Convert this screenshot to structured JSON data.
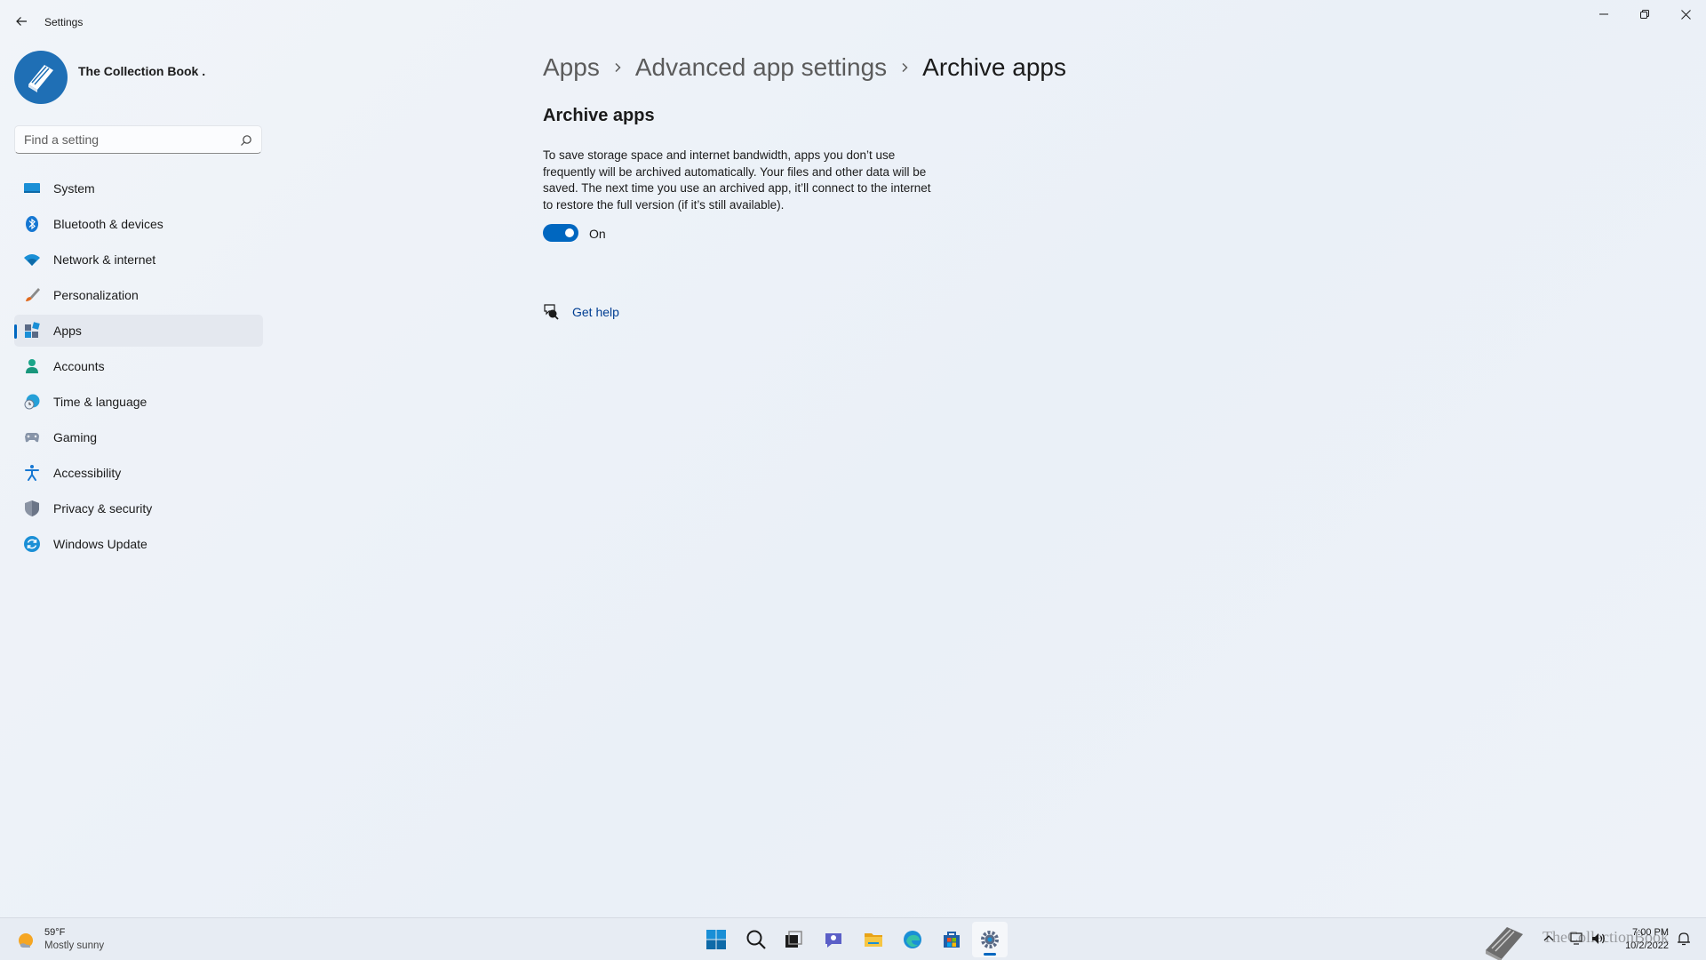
{
  "window": {
    "title": "Settings",
    "controls": {
      "minimize": "minimize",
      "restore": "restore",
      "close": "close"
    }
  },
  "profile": {
    "name": "The Collection Book ."
  },
  "search": {
    "placeholder": "Find a setting"
  },
  "sidebar": {
    "items": [
      {
        "label": "System",
        "icon": "system-icon",
        "selected": false
      },
      {
        "label": "Bluetooth & devices",
        "icon": "bluetooth-icon",
        "selected": false
      },
      {
        "label": "Network & internet",
        "icon": "wifi-icon",
        "selected": false
      },
      {
        "label": "Personalization",
        "icon": "brush-icon",
        "selected": false
      },
      {
        "label": "Apps",
        "icon": "apps-icon",
        "selected": true
      },
      {
        "label": "Accounts",
        "icon": "person-icon",
        "selected": false
      },
      {
        "label": "Time & language",
        "icon": "clock-globe-icon",
        "selected": false
      },
      {
        "label": "Gaming",
        "icon": "gamepad-icon",
        "selected": false
      },
      {
        "label": "Accessibility",
        "icon": "accessibility-icon",
        "selected": false
      },
      {
        "label": "Privacy & security",
        "icon": "shield-icon",
        "selected": false
      },
      {
        "label": "Windows Update",
        "icon": "update-icon",
        "selected": false
      }
    ]
  },
  "main": {
    "breadcrumb": [
      "Apps",
      "Advanced app settings",
      "Archive apps"
    ],
    "section_title": "Archive apps",
    "description": "To save storage space and internet bandwidth, apps you don’t use frequently will be archived automatically. Your files and other data will be saved. The next time you use an archived app, it’ll connect to the internet to restore the full version (if it’s still available).",
    "toggle": {
      "state": true,
      "label": "On"
    },
    "help_link": "Get help"
  },
  "taskbar": {
    "weather": {
      "temp": "59°F",
      "condition": "Mostly sunny"
    },
    "apps": [
      "start-icon",
      "search-icon",
      "task-view-icon",
      "chat-icon",
      "file-explorer-icon",
      "edge-icon",
      "store-icon",
      "settings-icon"
    ],
    "active_app": "settings-icon",
    "watermark": "TheCollectionBook",
    "time": "7:00 PM",
    "date": "10/2/2022"
  },
  "colors": {
    "accent": "#0067c0",
    "link": "#003e92",
    "background": "#eef2f8",
    "selected_nav": "#e4e8ef"
  }
}
